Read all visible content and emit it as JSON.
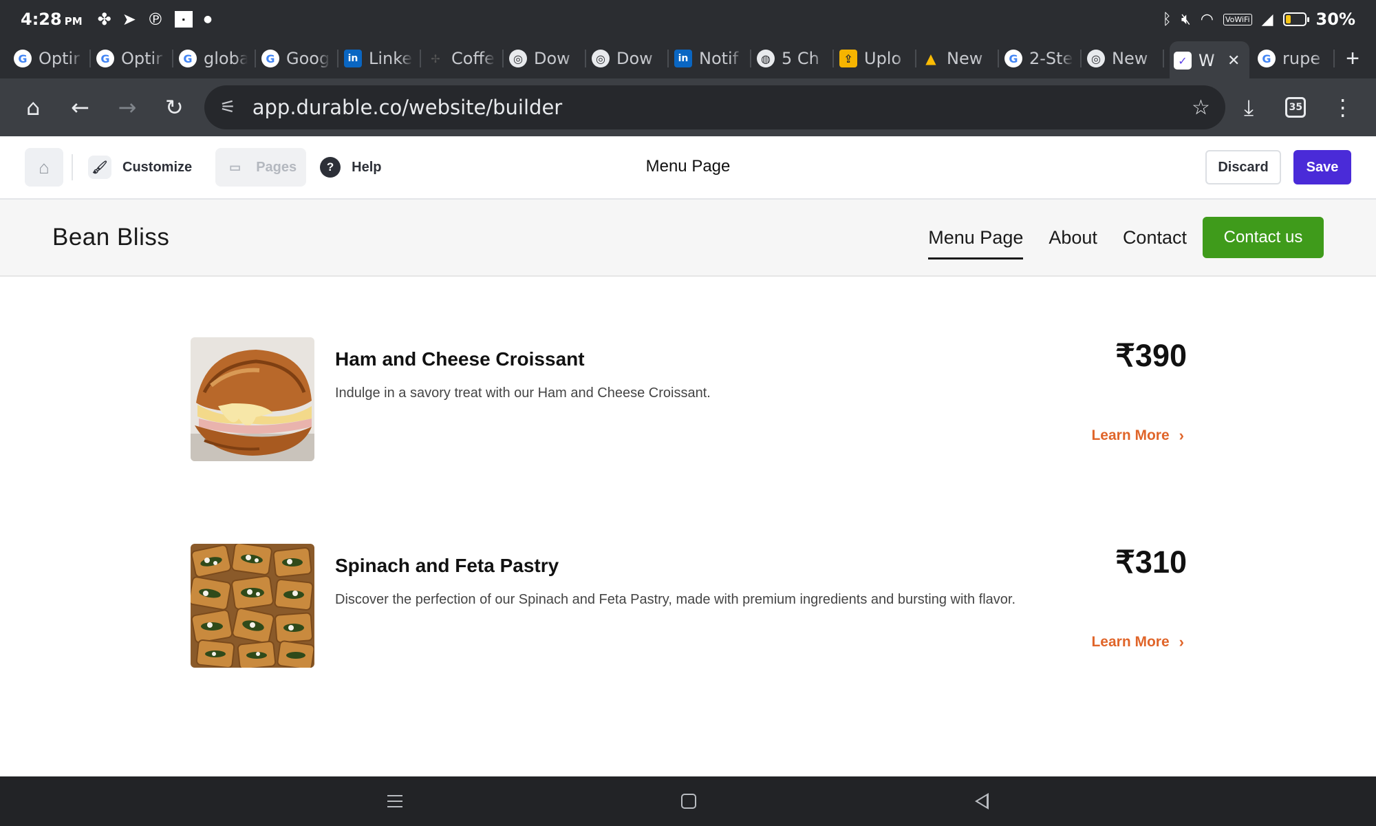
{
  "status_bar": {
    "time": "4:28",
    "ampm": "PM",
    "battery_percent": "30%",
    "battery_level": 0.3,
    "wifi_label": "VoWiFi"
  },
  "tabs": [
    {
      "label": "Optir",
      "icon": "google-icon"
    },
    {
      "label": "Optir",
      "icon": "google-icon"
    },
    {
      "label": "globa",
      "icon": "google-icon"
    },
    {
      "label": "Goog",
      "icon": "google-icon"
    },
    {
      "label": "Linke",
      "icon": "linkedin-icon"
    },
    {
      "label": "Coffe",
      "icon": "coffee-icon"
    },
    {
      "label": "Dow",
      "icon": "chrome-icon"
    },
    {
      "label": "Dow",
      "icon": "chrome-icon"
    },
    {
      "label": "Notif",
      "icon": "linkedin-icon"
    },
    {
      "label": "5 Ch",
      "icon": "globe-icon"
    },
    {
      "label": "Uplo",
      "icon": "upload-icon"
    },
    {
      "label": "New",
      "icon": "google-ads-icon"
    },
    {
      "label": "2-Ste",
      "icon": "google-icon"
    },
    {
      "label": "New",
      "icon": "chrome-icon"
    },
    {
      "label": "W",
      "icon": "durable-icon",
      "active": true
    },
    {
      "label": "rupe",
      "icon": "google-icon"
    }
  ],
  "toolbar": {
    "url": "app.durable.co/website/builder",
    "tab_count": "35"
  },
  "builder": {
    "customize_label": "Customize",
    "pages_label": "Pages",
    "help_label": "Help",
    "page_title": "Menu Page",
    "discard_label": "Discard",
    "save_label": "Save"
  },
  "site": {
    "brand": "Bean Bliss",
    "nav": [
      {
        "label": "Menu Page",
        "current": true
      },
      {
        "label": "About"
      },
      {
        "label": "Contact"
      }
    ],
    "cta_label": "Contact us",
    "accent_color": "#3f9b1b"
  },
  "menu_items": [
    {
      "name": "Ham and Cheese Croissant",
      "description": "Indulge in a savory treat with our Ham and Cheese Croissant.",
      "price": "₹390",
      "link_label": "Learn More",
      "image": "croissant-photo"
    },
    {
      "name": "Spinach and Feta Pastry",
      "description": "Discover the perfection of our Spinach and Feta Pastry, made with premium ingredients and bursting with flavor.",
      "price": "₹310",
      "link_label": "Learn More",
      "image": "pastry-photo"
    }
  ],
  "colors": {
    "save_button": "#4a2bd8",
    "learn_more": "#e0652a",
    "browser_chrome": "#2b2d31"
  }
}
